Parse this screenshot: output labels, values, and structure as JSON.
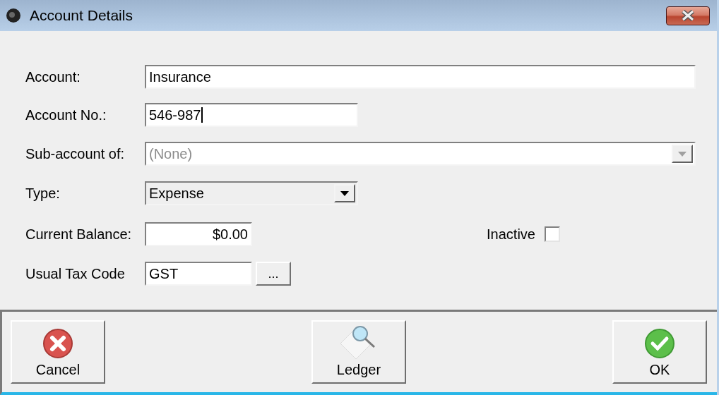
{
  "window": {
    "title": "Account Details"
  },
  "account": {
    "label": "Account:",
    "value": "Insurance"
  },
  "account_no": {
    "label": "Account No.:",
    "value": "546-987"
  },
  "sub_account": {
    "label": "Sub-account of:",
    "value": "(None)",
    "disabled": true
  },
  "type": {
    "label": "Type:",
    "value": "Expense",
    "disabled": false
  },
  "balance": {
    "label": "Current Balance:",
    "value": "$0.00"
  },
  "inactive": {
    "label": "Inactive",
    "checked": false
  },
  "tax_code": {
    "label": "Usual Tax Code",
    "value": "GST",
    "button": "..."
  },
  "buttons": [
    {
      "kind": "cancel",
      "label": "Cancel"
    },
    {
      "kind": "ledger",
      "label": "Ledger"
    },
    {
      "kind": "ok",
      "label": "OK"
    }
  ]
}
